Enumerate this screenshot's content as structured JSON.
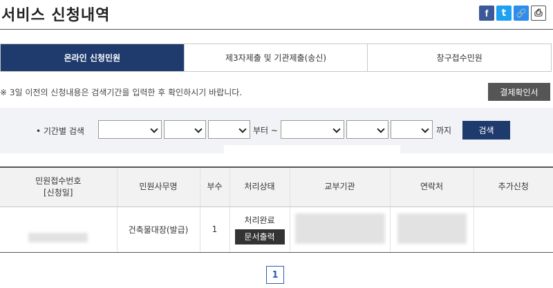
{
  "header": {
    "title": "서비스 신청내역"
  },
  "share": {
    "facebook": "f",
    "twitter": "t",
    "link": "🔗",
    "print": "⎙"
  },
  "tabs": [
    {
      "label": "온라인 신청민원",
      "active": true
    },
    {
      "label": "제3자제출 및 기관제출(송신)",
      "active": false
    },
    {
      "label": "창구접수민원",
      "active": false
    }
  ],
  "notice": "※ 3일 이전의 신청내용은 검색기간을 입력한 후 확인하시기 바랍니다.",
  "payment_button": "결제확인서",
  "search": {
    "label": "• 기간별 검색",
    "from_text": "부터 ~",
    "to_text": "까지",
    "button": "검색"
  },
  "table": {
    "headers": [
      "민원접수번호",
      "[신청일]",
      "민원사무명",
      "부수",
      "처리상태",
      "교부기관",
      "연락처",
      "추가신청"
    ],
    "rows": [
      {
        "service": "건축물대장(발급)",
        "copies": "1",
        "status": "처리완료",
        "action": "문서출력"
      }
    ]
  },
  "pagination": {
    "current": "1"
  },
  "colors": {
    "primary": "#1f3b6e",
    "dark_button": "#555555",
    "search_bg": "#f1f3f6"
  }
}
